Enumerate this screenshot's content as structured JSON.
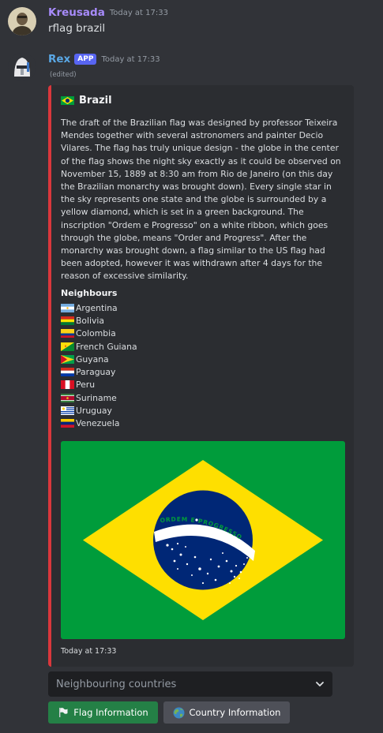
{
  "messages": [
    {
      "author": "Kreusada",
      "author_color": "#a78bfa",
      "timestamp": "Today at 17:33",
      "text": "rflag brazil"
    },
    {
      "author": "Rex",
      "author_color": "#5aa8e6",
      "badge": "APP",
      "timestamp": "Today at 17:33",
      "edited": "(edited)"
    }
  ],
  "embed": {
    "accent_color": "#da373c",
    "title": "Brazil",
    "description": "The draft of the Brazilian flag was designed by professor Teixeira Mendes together with several astronomers and painter Decio Vilares. The flag has truly unique design - the globe in the center of the flag shows the night sky exactly as it could be observed on November 15, 1889 at 8:30 am from Rio de Janeiro (on this day the Brazilian monarchy was brought down). Every single star in the sky represents one state and the globe is surrounded by a yellow diamond, which is set in a green background. The inscription \"Ordem e Progresso\" on a white ribbon, which goes through the globe, means \"Order and Progress\". After the monarchy was brought down, a flag similar to the US flag had been adopted, however it was withdrawn after 4 days for the reason of excessive similarity.",
    "field_name": "Neighbours",
    "neighbours": [
      "Argentina",
      "Bolivia",
      "Colombia",
      "French Guiana",
      "Guyana",
      "Paraguay",
      "Peru",
      "Suriname",
      "Uruguay",
      "Venezuela"
    ],
    "flag_motto": "ORDEM E PROGRESSO",
    "footer": "Today at 17:33"
  },
  "components": {
    "select_placeholder": "Neighbouring countries",
    "flag_button_label": "Flag Information",
    "country_button_label": "Country Information"
  }
}
